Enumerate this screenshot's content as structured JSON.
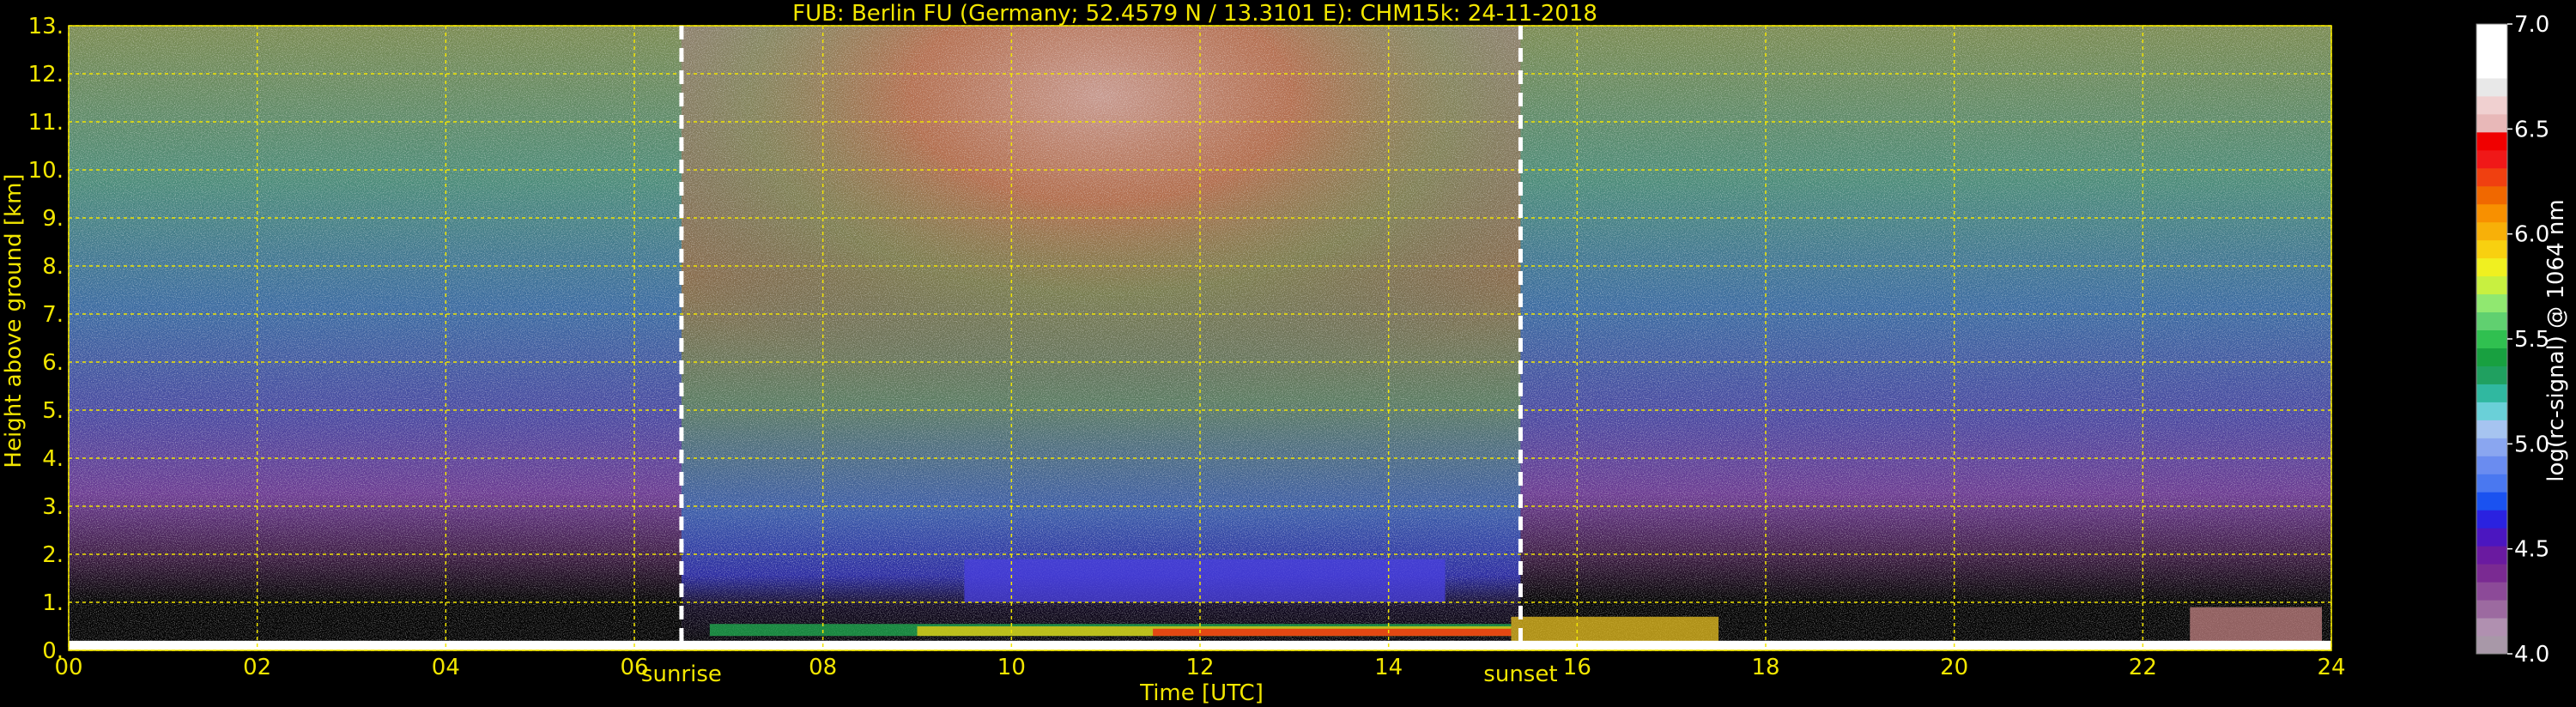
{
  "chart_data": {
    "type": "heatmap",
    "title": "FUB: Berlin FU (Germany; 52.4579 N / 13.3101 E):    CHM15k: 24-11-2018",
    "xlabel": "Time [UTC]",
    "ylabel": "Height above ground [km]",
    "xlim": [
      0,
      24
    ],
    "ylim": [
      0,
      13
    ],
    "x_ticks": [
      "00",
      "02",
      "04",
      "06",
      "08",
      "10",
      "12",
      "14",
      "16",
      "18",
      "20",
      "22",
      "24"
    ],
    "y_ticks": [
      "0.",
      "1.",
      "2.",
      "3.",
      "4.",
      "5.",
      "6.",
      "7.",
      "8.",
      "9.",
      "10.",
      "11.",
      "12.",
      "13."
    ],
    "grid": true,
    "markers": [
      {
        "label": "sunrise",
        "time": 6.5
      },
      {
        "label": "sunset",
        "time": 15.4
      }
    ],
    "colorbar": {
      "label": "log(rc-signal) @ 1064 nm",
      "range": [
        4.0,
        7.0
      ],
      "ticks": [
        "4.0",
        "4.5",
        "5.0",
        "5.5",
        "6.0",
        "6.5",
        "7.0"
      ],
      "colors": [
        "#a898a8",
        "#b090b0",
        "#9c6aa0",
        "#8c4a98",
        "#7a2a92",
        "#6a1aa0",
        "#4b16c0",
        "#2a22e0",
        "#1a52f0",
        "#4a78f0",
        "#6a8cf0",
        "#8aa6f0",
        "#a6c4f0",
        "#6ad0d8",
        "#30b8a0",
        "#20a060",
        "#18a040",
        "#30c050",
        "#60d070",
        "#90e870",
        "#c8f040",
        "#f0f020",
        "#f8d010",
        "#f8b008",
        "#f89000",
        "#f06800",
        "#f04010",
        "#f01818",
        "#f00000",
        "#e8b8b8",
        "#f0d0d0",
        "#e8e8e8",
        "#ffffff",
        "#ffffff",
        "#ffffff"
      ]
    }
  }
}
